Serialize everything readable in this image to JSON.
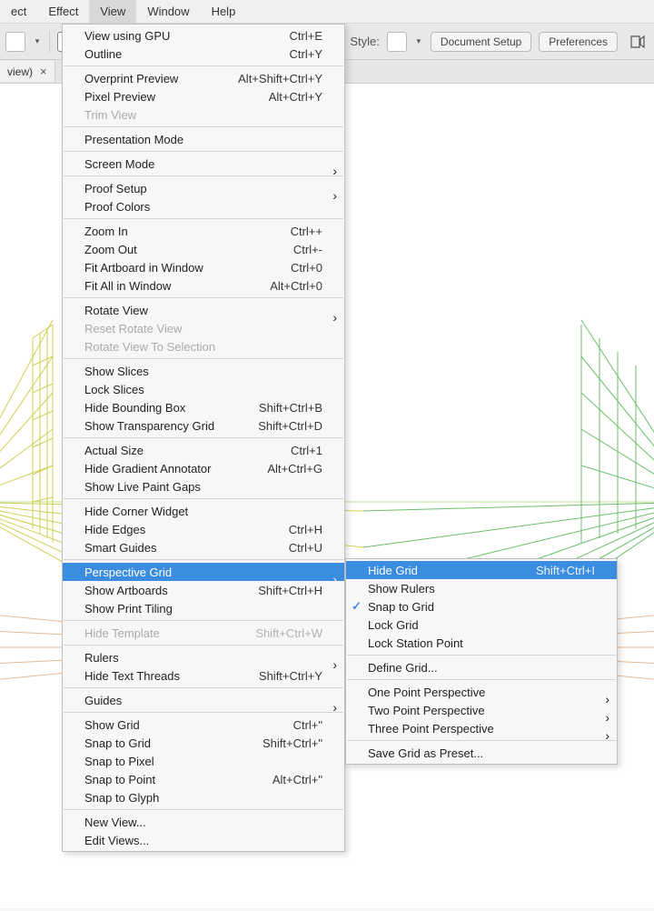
{
  "menubar": {
    "items": [
      "ect",
      "Effect",
      "View",
      "Window",
      "Help"
    ],
    "active_index": 2
  },
  "toolbar": {
    "style_label": "Style:",
    "btn_doc_setup": "Document Setup",
    "btn_preferences": "Preferences"
  },
  "doc_tab": {
    "label": "view)",
    "close": "×"
  },
  "view_menu": {
    "groups": [
      [
        {
          "label": "View using GPU",
          "shortcut": "Ctrl+E"
        },
        {
          "label": "Outline",
          "shortcut": "Ctrl+Y"
        }
      ],
      [
        {
          "label": "Overprint Preview",
          "shortcut": "Alt+Shift+Ctrl+Y"
        },
        {
          "label": "Pixel Preview",
          "shortcut": "Alt+Ctrl+Y"
        },
        {
          "label": "Trim View",
          "disabled": true
        }
      ],
      [
        {
          "label": "Presentation Mode"
        }
      ],
      [
        {
          "label": "Screen Mode",
          "submenu": true
        }
      ],
      [
        {
          "label": "Proof Setup",
          "submenu": true
        },
        {
          "label": "Proof Colors"
        }
      ],
      [
        {
          "label": "Zoom In",
          "shortcut": "Ctrl++"
        },
        {
          "label": "Zoom Out",
          "shortcut": "Ctrl+-"
        },
        {
          "label": "Fit Artboard in Window",
          "shortcut": "Ctrl+0"
        },
        {
          "label": "Fit All in Window",
          "shortcut": "Alt+Ctrl+0"
        }
      ],
      [
        {
          "label": "Rotate View",
          "submenu": true
        },
        {
          "label": "Reset Rotate View",
          "disabled": true
        },
        {
          "label": "Rotate View To Selection",
          "disabled": true
        }
      ],
      [
        {
          "label": "Show Slices"
        },
        {
          "label": "Lock Slices"
        },
        {
          "label": "Hide Bounding Box",
          "shortcut": "Shift+Ctrl+B"
        },
        {
          "label": "Show Transparency Grid",
          "shortcut": "Shift+Ctrl+D"
        }
      ],
      [
        {
          "label": "Actual Size",
          "shortcut": "Ctrl+1"
        },
        {
          "label": "Hide Gradient Annotator",
          "shortcut": "Alt+Ctrl+G"
        },
        {
          "label": "Show Live Paint Gaps"
        }
      ],
      [
        {
          "label": "Hide Corner Widget"
        },
        {
          "label": "Hide Edges",
          "shortcut": "Ctrl+H"
        },
        {
          "label": "Smart Guides",
          "shortcut": "Ctrl+U"
        }
      ],
      [
        {
          "label": "Perspective Grid",
          "submenu": true,
          "highlight": true
        },
        {
          "label": "Show Artboards",
          "shortcut": "Shift+Ctrl+H"
        },
        {
          "label": "Show Print Tiling"
        }
      ],
      [
        {
          "label": "Hide Template",
          "shortcut": "Shift+Ctrl+W",
          "disabled": true
        }
      ],
      [
        {
          "label": "Rulers",
          "submenu": true
        },
        {
          "label": "Hide Text Threads",
          "shortcut": "Shift+Ctrl+Y"
        }
      ],
      [
        {
          "label": "Guides",
          "submenu": true
        }
      ],
      [
        {
          "label": "Show Grid",
          "shortcut": "Ctrl+\""
        },
        {
          "label": "Snap to Grid",
          "shortcut": "Shift+Ctrl+\""
        },
        {
          "label": "Snap to Pixel"
        },
        {
          "label": "Snap to Point",
          "shortcut": "Alt+Ctrl+\""
        },
        {
          "label": "Snap to Glyph"
        }
      ],
      [
        {
          "label": "New View..."
        },
        {
          "label": "Edit Views..."
        }
      ]
    ]
  },
  "submenu": {
    "groups": [
      [
        {
          "label": "Hide Grid",
          "shortcut": "Shift+Ctrl+I",
          "highlight": true
        },
        {
          "label": "Show Rulers"
        },
        {
          "label": "Snap to Grid",
          "checked": true
        },
        {
          "label": "Lock Grid"
        },
        {
          "label": "Lock Station Point"
        }
      ],
      [
        {
          "label": "Define Grid..."
        }
      ],
      [
        {
          "label": "One Point Perspective",
          "submenu": true
        },
        {
          "label": "Two Point Perspective",
          "submenu": true
        },
        {
          "label": "Three Point Perspective",
          "submenu": true
        }
      ],
      [
        {
          "label": "Save Grid as Preset..."
        }
      ]
    ]
  }
}
